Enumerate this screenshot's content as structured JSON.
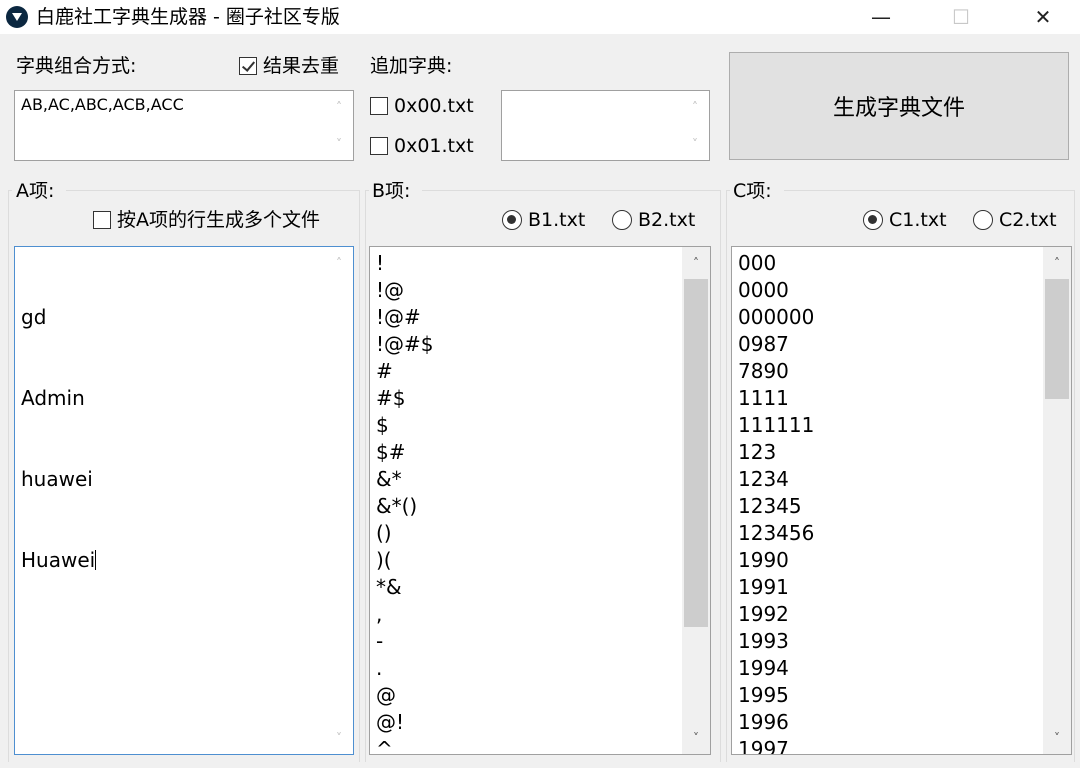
{
  "window": {
    "title": "白鹿社工字典生成器 - 圈子社区专版",
    "minimize": "—",
    "maximize": "☐",
    "close": "✕"
  },
  "combo": {
    "label": "字典组合方式:",
    "dedupe_label": "结果去重",
    "dedupe_checked": true,
    "value": "AB,AC,ABC,ACB,ACC"
  },
  "append": {
    "label": "追加字典:",
    "options": [
      {
        "label": "0x00.txt",
        "checked": false
      },
      {
        "label": "0x01.txt",
        "checked": false
      }
    ],
    "value": ""
  },
  "generate_button": "生成字典文件",
  "group_a": {
    "label": "A项:",
    "multi_file_label": "按A项的行生成多个文件",
    "multi_file_checked": false,
    "lines": [
      "gd",
      "Admin",
      "huawei",
      "Huawei"
    ]
  },
  "group_b": {
    "label": "B项:",
    "radios": [
      {
        "label": "B1.txt",
        "selected": true
      },
      {
        "label": "B2.txt",
        "selected": false
      }
    ],
    "lines": [
      "!",
      "!@",
      "!@#",
      "!@#$",
      "#",
      "#$",
      "$",
      "$#",
      "&*",
      "&*()",
      "()",
      ")(",
      "*&",
      ",",
      "-",
      ".",
      "@",
      "@!",
      "^"
    ]
  },
  "group_c": {
    "label": "C项:",
    "radios": [
      {
        "label": "C1.txt",
        "selected": true
      },
      {
        "label": "C2.txt",
        "selected": false
      }
    ],
    "lines": [
      "000",
      "0000",
      "000000",
      "0987",
      "7890",
      "1111",
      "111111",
      "123",
      "1234",
      "12345",
      "123456",
      "1990",
      "1991",
      "1992",
      "1993",
      "1994",
      "1995",
      "1996",
      "1997"
    ]
  },
  "icons": {
    "app": "deer-icon",
    "scroll_up": "chevron-up-icon",
    "scroll_down": "chevron-down-icon"
  }
}
